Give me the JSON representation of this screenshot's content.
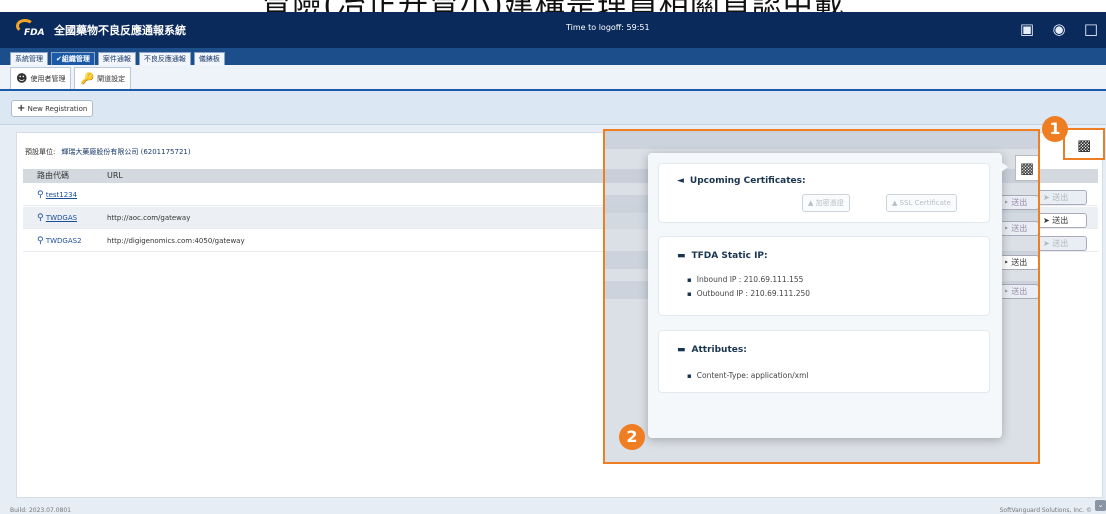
{
  "caption": "冒險(冶正升冒小)建構是理員相關負認中載",
  "header": {
    "logo_text": "FDA",
    "title": "全國藥物不良反應通報系統",
    "timer": "Time to logoff: 59:51",
    "icons": [
      "device-icon",
      "user-icon",
      "logout-icon"
    ]
  },
  "tabs": [
    {
      "label": "系統管理",
      "active": false
    },
    {
      "label": "✔組織管理",
      "active": true
    },
    {
      "label": "案件通報",
      "active": false
    },
    {
      "label": "不良反應通報",
      "active": false
    },
    {
      "label": "儀錶板",
      "active": false
    }
  ],
  "subtabs": [
    {
      "label": "使用者管理",
      "icon": "user-admin-icon"
    },
    {
      "label": "閘道設定",
      "icon": "key-icon"
    }
  ],
  "toolbar": {
    "new_label": "New Registration"
  },
  "unit": {
    "label": "預設單位:",
    "value": "輝瑞大藥廠股份有限公司 (62011757​21)"
  },
  "grid": {
    "columns": [
      "路由代碼",
      "URL"
    ],
    "rows": [
      {
        "code": "test1234",
        "url": ""
      },
      {
        "code": "TWDGAS",
        "url": "http://aoc.com/gateway"
      },
      {
        "code": "TWDGAS2",
        "url": "http://digigenomics.com:4050/gateway"
      }
    ]
  },
  "behind_buttons": [
    "➤ 送出",
    "➤ 送出",
    "➤ 送出"
  ],
  "overlay_buttons": [
    "‣ 送出",
    "‣ 送出",
    "‣ 送出",
    "‣ 送出"
  ],
  "popover": {
    "certificates": {
      "title": "Upcoming Certificates:",
      "buttons": [
        "加密憑證",
        "SSL Certificate"
      ]
    },
    "static_ip": {
      "title": "TFDA Static IP:",
      "items": [
        "Inbound IP : 210.69.111.155",
        "Outbound IP : 210.69.111.250"
      ]
    },
    "attributes": {
      "title": "Attributes:",
      "items": [
        "Content-Type: application/xml"
      ]
    }
  },
  "badges": {
    "one": "1",
    "two": "2"
  },
  "footer": {
    "build": "Build: 2023.07.0801",
    "company": "SoftVanguard Solutions, Inc. ©"
  },
  "colors": {
    "header": "#0a2a5c",
    "accent": "#ef7d22",
    "link": "#1a4e9c"
  }
}
